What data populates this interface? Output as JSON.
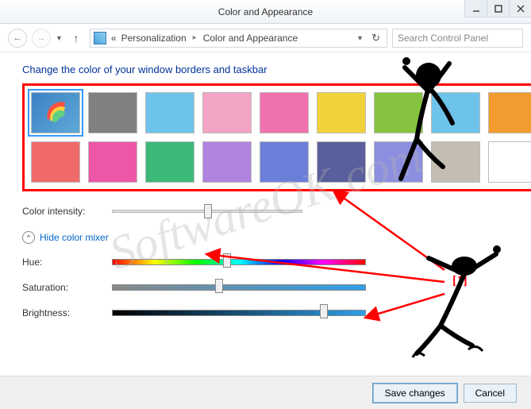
{
  "window": {
    "title": "Color and Appearance"
  },
  "breadcrumb": {
    "prefix": "«",
    "items": [
      "Personalization",
      "Color and Appearance"
    ]
  },
  "search": {
    "placeholder": "Search Control Panel"
  },
  "heading": "Change the color of your window borders and taskbar",
  "swatches": {
    "rows": [
      [
        "auto",
        "#808080",
        "#6ec3eb",
        "#f3a3c3",
        "#f072ac",
        "#f2d23a",
        "#86c440",
        "#6ec3eb",
        "#f29b2e"
      ],
      [
        "#f16a6a",
        "#ee56a8",
        "#3cb878",
        "#b084e0",
        "#6b7fd9",
        "#595f9c",
        "#8c8fe0",
        "#c4bdb3",
        "#ffffff"
      ]
    ],
    "selected": [
      0,
      0
    ]
  },
  "intensity": {
    "label": "Color intensity:",
    "value": 50
  },
  "mixer": {
    "toggle": "Hide color mixer",
    "hue": {
      "label": "Hue:",
      "value": 45
    },
    "saturation": {
      "label": "Saturation:",
      "value": 42
    },
    "brightness": {
      "label": "Brightness:",
      "value": 83
    }
  },
  "footer": {
    "save": "Save changes",
    "cancel": "Cancel"
  },
  "watermark": "SoftwareOK.com",
  "annotation": {
    "label": "[1]"
  }
}
